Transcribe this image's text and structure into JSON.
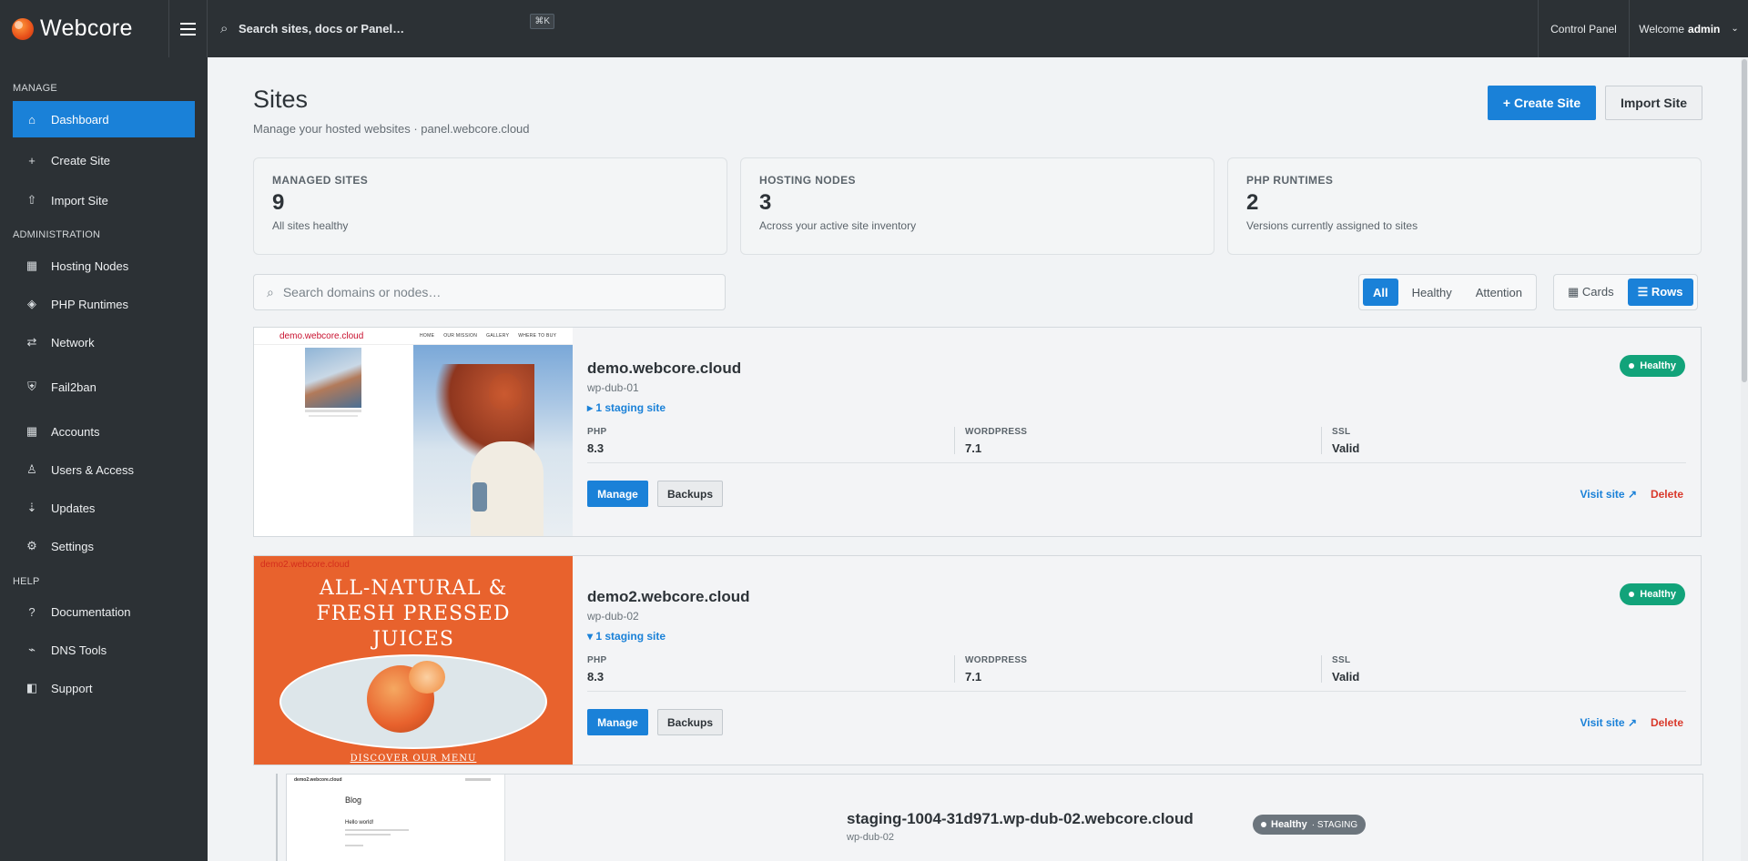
{
  "topbar": {
    "brand": "Webcore",
    "search_placeholder": "Search sites, docs or Panel…",
    "shortcut": "⌘K",
    "control_panel": "Control Panel",
    "welcome": "Welcome",
    "user": "admin"
  },
  "sidebar": {
    "sections": {
      "manage": "MANAGE",
      "administration": "ADMINISTRATION",
      "help": "HELP"
    },
    "items": [
      {
        "label": "Dashboard",
        "icon": "home-icon",
        "glyph": "⌂",
        "active": true
      },
      {
        "label": "Create Site",
        "icon": "plus-icon",
        "glyph": "+"
      },
      {
        "label": "Import Site",
        "icon": "upload-icon",
        "glyph": "⇧"
      },
      {
        "label": "Hosting Nodes",
        "icon": "server-icon",
        "glyph": "▦"
      },
      {
        "label": "PHP Runtimes",
        "icon": "code-icon",
        "glyph": "◈"
      },
      {
        "label": "Network",
        "icon": "network-icon",
        "glyph": "⇄"
      },
      {
        "label": "Fail2ban",
        "icon": "shield-icon",
        "glyph": "⛨"
      },
      {
        "label": "Accounts",
        "icon": "accounts-icon",
        "glyph": "▦"
      },
      {
        "label": "Users & Access",
        "icon": "user-icon",
        "glyph": "♙"
      },
      {
        "label": "Updates",
        "icon": "updates-icon",
        "glyph": "⇣"
      },
      {
        "label": "Settings",
        "icon": "gear-icon",
        "glyph": "⚙"
      },
      {
        "label": "Documentation",
        "icon": "help-icon",
        "glyph": "?"
      },
      {
        "label": "DNS Tools",
        "icon": "dns-icon",
        "glyph": "⌁"
      },
      {
        "label": "Support",
        "icon": "support-icon",
        "glyph": "◧"
      }
    ]
  },
  "page": {
    "title": "Sites",
    "subtitle": "Manage your hosted websites · panel.webcore.cloud",
    "create_button": "+ Create Site",
    "import_button": "Import Site"
  },
  "stats": [
    {
      "label": "MANAGED SITES",
      "value": "9",
      "note": "All sites healthy"
    },
    {
      "label": "HOSTING NODES",
      "value": "3",
      "note": "Across your active site inventory"
    },
    {
      "label": "PHP RUNTIMES",
      "value": "2",
      "note": "Versions currently assigned to sites"
    }
  ],
  "filter": {
    "placeholder": "Search domains or nodes…",
    "status_options": [
      "All",
      "Healthy",
      "Attention"
    ],
    "status_selected": "All",
    "view_options": [
      "▦ Cards",
      "☰ Rows"
    ],
    "view_selected": "☰ Rows"
  },
  "sites": [
    {
      "domain": "demo.webcore.cloud",
      "node": "wp-dub-01",
      "staging": "▸ 1 staging site",
      "status": "Healthy",
      "php_label": "PHP",
      "php": "8.3",
      "wp_label": "WORDPRESS",
      "wp": "7.1",
      "ssl_label": "SSL",
      "ssl": "Valid",
      "manage": "Manage",
      "backups": "Backups",
      "visit": "Visit site ↗",
      "delete": "Delete",
      "thumb_label": "demo.webcore.cloud",
      "thumb_nav": [
        "HOME",
        "OUR MISSION",
        "GALLERY",
        "WHERE TO BUY"
      ]
    },
    {
      "domain": "demo2.webcore.cloud",
      "node": "wp-dub-02",
      "staging": "▾ 1 staging site",
      "status": "Healthy",
      "php_label": "PHP",
      "php": "8.3",
      "wp_label": "WORDPRESS",
      "wp": "7.1",
      "ssl_label": "SSL",
      "ssl": "Valid",
      "manage": "Manage",
      "backups": "Backups",
      "visit": "Visit site ↗",
      "delete": "Delete",
      "thumb_label": "demo2.webcore.cloud",
      "thumb_headline": "ALL-NATURAL & FRESH PRESSED JUICES",
      "thumb_cta": "DISCOVER OUR MENU"
    }
  ],
  "staging_site": {
    "domain": "staging-1004-31d971.wp-dub-02.webcore.cloud",
    "node": "wp-dub-02",
    "status": "Healthy",
    "tag": "· STAGING",
    "thumb_label": "demo2.webcore.cloud",
    "thumb_title": "Blog",
    "thumb_post": "Hello world!"
  },
  "colors": {
    "accent": "#1a81d8",
    "healthy": "#12a37a",
    "danger": "#d9392b",
    "sidebar_bg": "#2c3135"
  }
}
